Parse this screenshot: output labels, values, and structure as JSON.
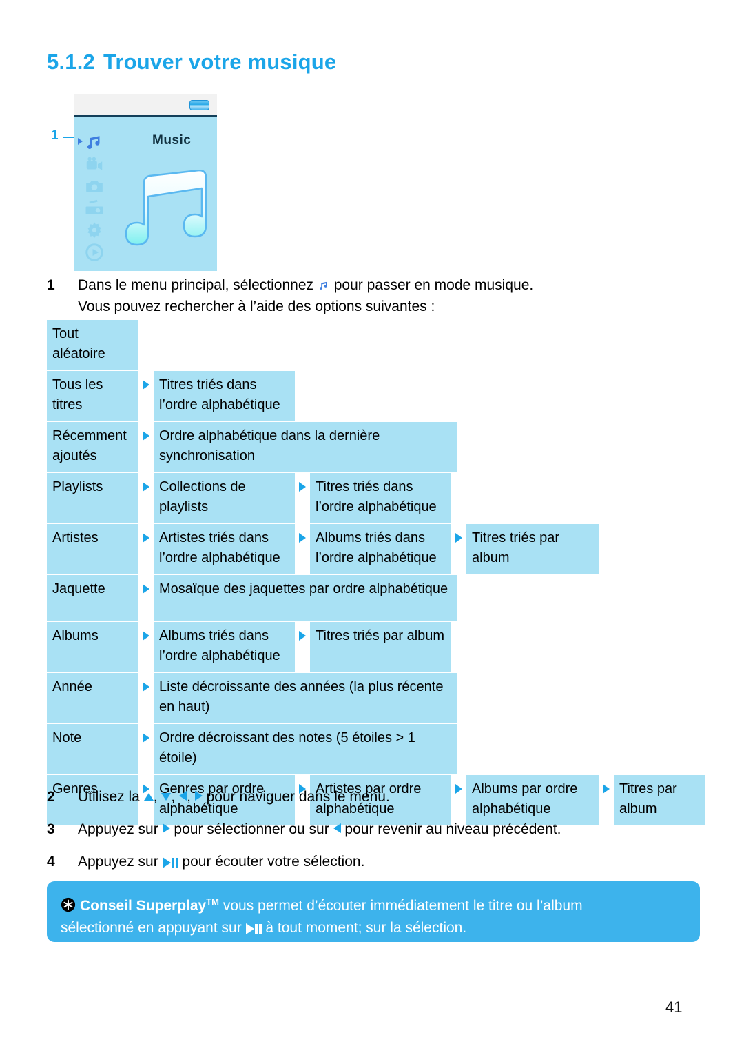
{
  "document": {
    "heading_number": "5.1.2",
    "heading_title": "Trouver votre musique",
    "page_number": "41"
  },
  "device_screenshot": {
    "callout_label": "1",
    "screen_title": "Music",
    "sidebar_icons": [
      "music-note-icon",
      "video-camera-icon",
      "photo-camera-icon",
      "radio-icon",
      "settings-gear-icon",
      "play-circle-icon"
    ],
    "battery_icon": "battery-icon"
  },
  "steps": [
    {
      "number": "1",
      "line1_before": "Dans le menu principal, sélectionnez",
      "line1_after": "pour passer en mode musique.",
      "line2": "Vous pouvez rechercher à l’aide des options suivantes :"
    },
    {
      "number": "2",
      "before": "Utilisez la",
      "after": "pour naviguer dans le menu.",
      "sep1": ",",
      "sep2": ",",
      "sep3": ","
    },
    {
      "number": "3",
      "part1": "Appuyez sur",
      "part2": "pour sélectionner ou sur",
      "part3": "pour revenir au niveau précédent."
    },
    {
      "number": "4",
      "part1": "Appuyez sur",
      "part2": "pour écouter votre sélection."
    }
  ],
  "flow_table": {
    "rows": [
      {
        "col1": "Tout aléatoire",
        "col2": "",
        "col3": "",
        "col4": "",
        "col5": ""
      },
      {
        "col1": "Tous les titres",
        "col2": "Titres triés dans l’ordre alphabétique",
        "col3": "",
        "col4": "",
        "col5": ""
      },
      {
        "col1": "Récemment ajoutés",
        "col2": "Ordre alphabétique dans la dernière synchronisation",
        "col3": "",
        "col4": "",
        "col5": ""
      },
      {
        "col1": "Playlists",
        "col2": "Collections de playlists",
        "col3": "Titres triés dans l’ordre alphabétique",
        "col4": "",
        "col5": ""
      },
      {
        "col1": "Artistes",
        "col2": "Artistes triés dans l’ordre alphabétique",
        "col3": "Albums triés dans l’ordre alphabétique",
        "col4": "Titres triés par album",
        "col5": ""
      },
      {
        "col1": "Jaquette",
        "col2": "Mosaïque des jaquettes par ordre alphabétique",
        "col3": "",
        "col4": "",
        "col5": ""
      },
      {
        "col1": "Albums",
        "col2": "Albums triés dans l’ordre alphabétique",
        "col3": "Titres triés par album",
        "col4": "",
        "col5": ""
      },
      {
        "col1": "Année",
        "col2": "Liste décroissante des années (la plus récente en haut)",
        "col3": "",
        "col4": "",
        "col5": ""
      },
      {
        "col1": "Note",
        "col2": "Ordre décroissant des notes (5 étoiles > 1 étoile)",
        "col3": "",
        "col4": "",
        "col5": ""
      },
      {
        "col1": "Genres",
        "col2": "Genres par ordre alphabétique",
        "col3": "Artistes par ordre alphabétique",
        "col4": "Albums par ordre alphabétique",
        "col5": "Titres par album"
      }
    ]
  },
  "tip_banner": {
    "icon": "asterisk-badge-icon",
    "bold_text": "Conseil Superplay",
    "trademark": "TM",
    "text_part1": "vous permet d’écouter immédiatement le titre ou l’album",
    "text_part2": "sélectionné en appuyant sur",
    "text_part3": "à tout moment; sur la sélection."
  },
  "colors": {
    "heading_blue": "#1ba5e8",
    "cell_blue": "#a9e1f4",
    "banner_blue": "#3db3ec",
    "arrow_blue": "#1ba5e8"
  }
}
